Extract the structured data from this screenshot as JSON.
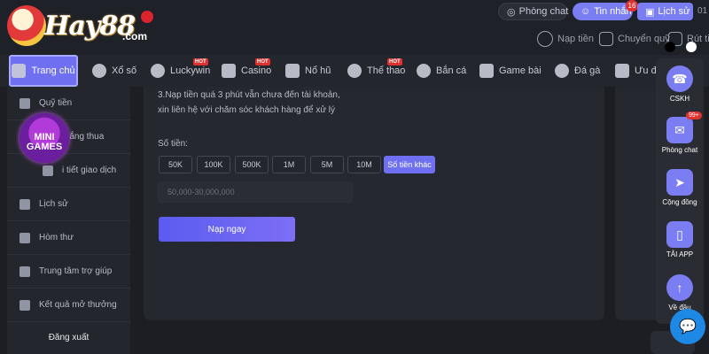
{
  "header": {
    "logo_text": "Hay88",
    "logo_suffix": ".com",
    "chat_label": "Phòng chat",
    "messages_label": "Tin nhắn",
    "messages_count": "16",
    "history_label": "Lịch sử",
    "clipped_text": "01",
    "deposit_label": "Nạp tiền",
    "transfer_label": "Chuyển quỹ",
    "withdraw_label": "Rút tiền"
  },
  "nav": {
    "items": [
      {
        "label": "Trang chủ",
        "icon": "home-icon"
      },
      {
        "label": "Xổ số",
        "icon": "lottery-icon"
      },
      {
        "label": "Luckywin",
        "icon": "luckywin-icon",
        "hot": "HOT"
      },
      {
        "label": "Casino",
        "icon": "casino-icon",
        "hot": "HOT"
      },
      {
        "label": "Nổ hũ",
        "icon": "slot-icon"
      },
      {
        "label": "Thể thao",
        "icon": "sports-icon",
        "hot": "HOT"
      },
      {
        "label": "Bắn cá",
        "icon": "fish-icon"
      },
      {
        "label": "Game bài",
        "icon": "cards-icon"
      },
      {
        "label": "Đá gà",
        "icon": "rooster-icon"
      },
      {
        "label": "Ưu đãi",
        "icon": "gift-icon"
      }
    ]
  },
  "sidebar": {
    "items": [
      {
        "label": "Quỹ tiền",
        "icon": "wallet-icon"
      },
      {
        "label": "thắng thua",
        "icon": "chart-icon"
      },
      {
        "label": "i tiết giao dịch",
        "icon": "transaction-icon"
      },
      {
        "label": "Lịch sử",
        "icon": "history-icon"
      },
      {
        "label": "Hòm thư",
        "icon": "mailbox-icon"
      },
      {
        "label": "Trung tâm trợ giúp",
        "icon": "help-icon"
      },
      {
        "label": "Kết quả mở thưởng",
        "icon": "trophy-icon"
      }
    ],
    "logout_label": "Đăng xuất",
    "mini_games_line1": "MINI",
    "mini_games_line2": "GAMES"
  },
  "main": {
    "note_line1": "3.Nạp tiền quá 3 phút vẫn chưa đến tài khoản,",
    "note_line2": "xin liên hệ với chăm sóc khách hàng để xử lý",
    "amount_label": "Số tiền:",
    "amount_options": [
      "50K",
      "100K",
      "500K",
      "1M",
      "5M",
      "10M",
      "Số tiền khác"
    ],
    "selected_option": "Số tiền khác",
    "amount_placeholder": "50,000-30,000,000",
    "submit_label": "Nạp ngay"
  },
  "dock": {
    "items": [
      {
        "label": "CSKH",
        "icon": "support-icon"
      },
      {
        "label": "Phòng chat",
        "icon": "chat-icon",
        "badge": "99+"
      },
      {
        "label": "Cộng đồng",
        "icon": "telegram-icon"
      },
      {
        "label": "TẢI APP",
        "icon": "phone-icon"
      },
      {
        "label": "Về đầu",
        "icon": "arrow-up-icon"
      }
    ]
  },
  "colors": {
    "accent": "#6f6ff2",
    "background": "#1c1e24",
    "panel": "#26282f",
    "hot_badge": "#e03131",
    "chat_fab": "#1e88e5"
  }
}
